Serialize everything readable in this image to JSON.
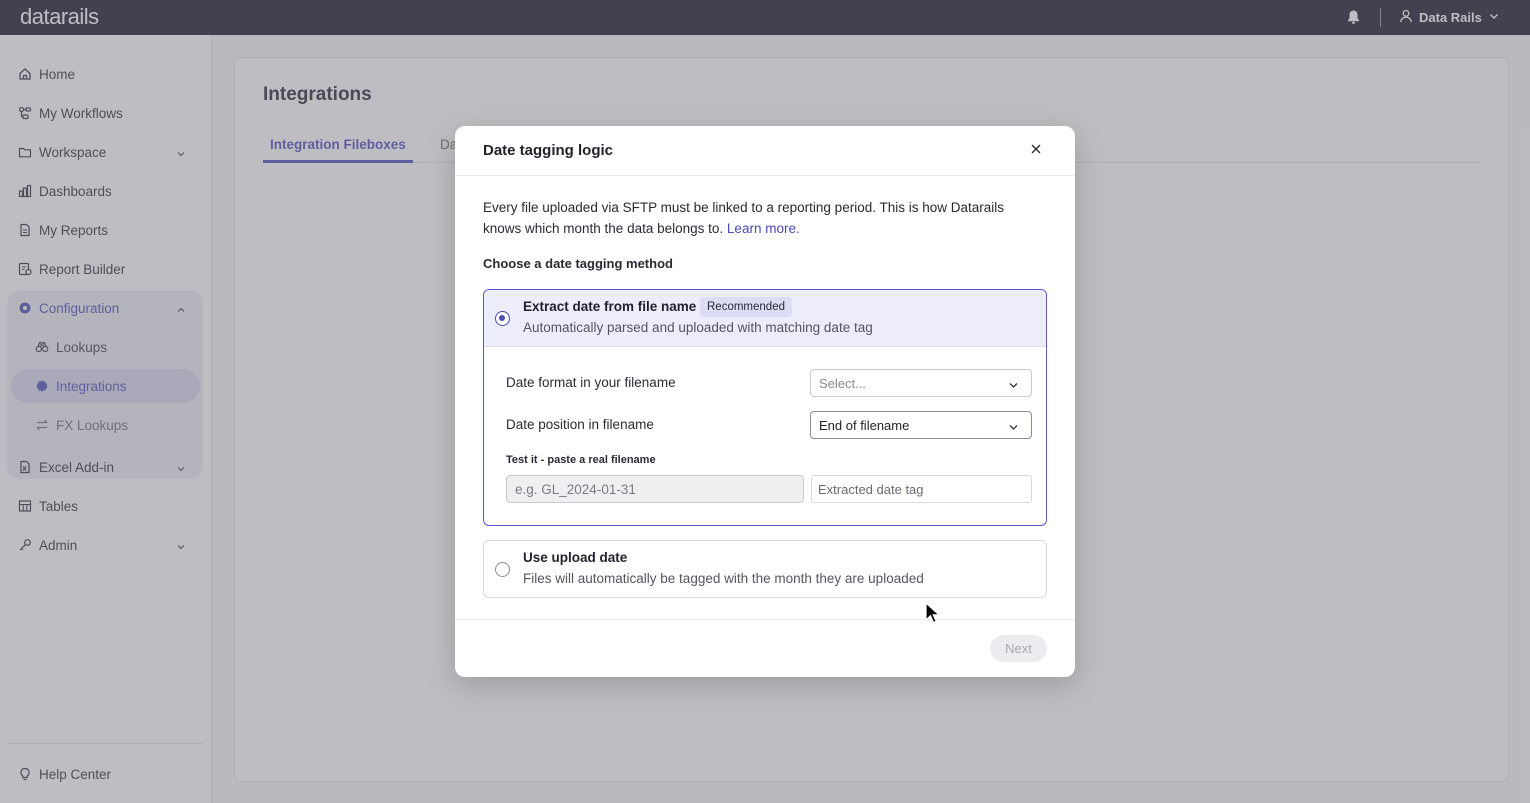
{
  "app": {
    "logo_text": "datarails",
    "user_name": "Data Rails"
  },
  "sidebar": {
    "items": [
      {
        "label": "Home",
        "icon": "home-icon"
      },
      {
        "label": "My Workflows",
        "icon": "workflow-icon"
      },
      {
        "label": "Workspace",
        "icon": "folder-icon"
      },
      {
        "label": "Dashboards",
        "icon": "chart-icon"
      },
      {
        "label": "My Reports",
        "icon": "document-icon"
      },
      {
        "label": "Report Builder",
        "icon": "report-builder-icon"
      },
      {
        "label": "Configuration",
        "icon": "gear-icon"
      },
      {
        "label": "Excel Add-in",
        "icon": "excel-icon"
      },
      {
        "label": "Tables",
        "icon": "table-icon"
      },
      {
        "label": "Admin",
        "icon": "key-icon"
      }
    ],
    "config_sub": [
      {
        "label": "Lookups",
        "icon": "binoculars-icon"
      },
      {
        "label": "Integrations",
        "icon": "gear-icon"
      },
      {
        "label": "FX Lookups",
        "icon": "swap-icon"
      }
    ],
    "help_label": "Help Center"
  },
  "main": {
    "title": "Integrations",
    "tabs": [
      {
        "label": "Integration Fileboxes"
      },
      {
        "label": "Da"
      }
    ]
  },
  "modal": {
    "title": "Date tagging logic",
    "intro_text": "Every file uploaded via SFTP must be linked to a reporting period. This is how Datarails knows which month the data belongs to.",
    "learn_more": "Learn more.",
    "section_label": "Choose a date tagging method",
    "option1": {
      "title": "Extract date from file name",
      "badge": "Recommended",
      "description": "Automatically parsed and uploaded with matching date tag",
      "selected": true,
      "date_format_label": "Date format in your filename",
      "date_format_placeholder": "Select...",
      "date_position_label": "Date position in filename",
      "date_position_value": "End of filename",
      "test_label": "Test it - paste a real filename",
      "test_placeholder": "e.g. GL_2024-01-31",
      "extracted_placeholder": "Extracted date tag"
    },
    "option2": {
      "title": "Use upload date",
      "description": "Files will automatically be tagged with the month they are uploaded",
      "selected": false
    },
    "next_label": "Next"
  },
  "colors": {
    "topbar": "#101025",
    "accent": "#4a4ab8",
    "selected_bg": "#ececfb"
  }
}
